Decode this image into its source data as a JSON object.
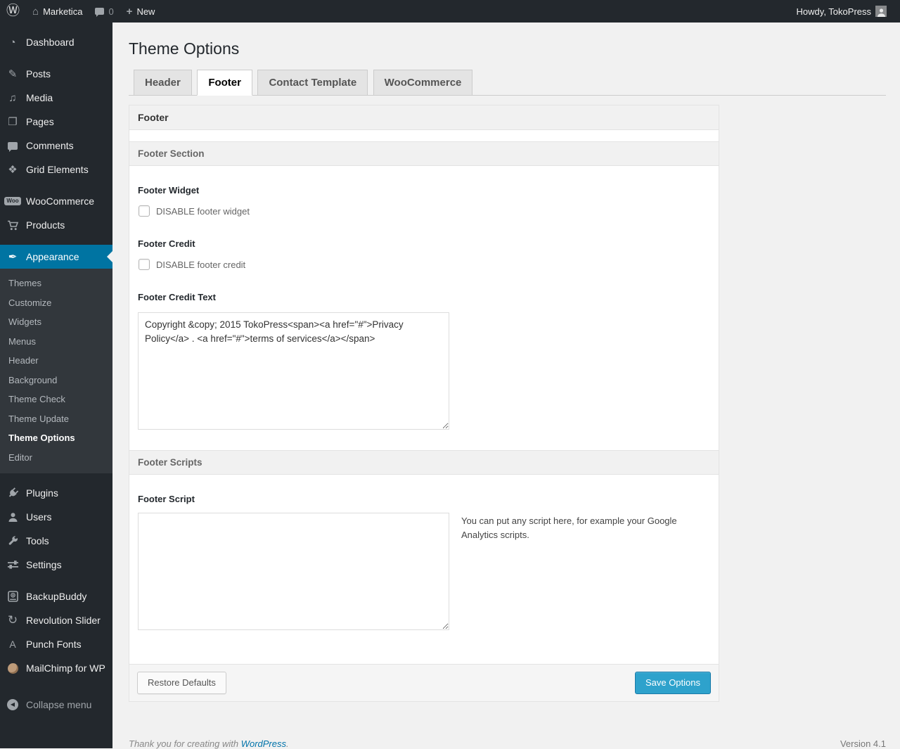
{
  "admin_bar": {
    "icons": {
      "wp": "Ⓦ",
      "home": "⌂",
      "plus": "+"
    },
    "site_name": "Marketica",
    "comments_count": "0",
    "new_label": "New",
    "howdy": "Howdy, TokoPress"
  },
  "sidebar": {
    "items": [
      {
        "label": "Dashboard",
        "glyph": "◔"
      },
      {
        "label": "Posts",
        "glyph": "✎"
      },
      {
        "label": "Media",
        "glyph": "♫"
      },
      {
        "label": "Pages",
        "glyph": "❐"
      },
      {
        "label": "Comments",
        "glyph": ""
      },
      {
        "label": "Grid Elements",
        "glyph": "❖"
      },
      {
        "label": "WooCommerce",
        "glyph": "Woo"
      },
      {
        "label": "Products",
        "glyph": ""
      },
      {
        "label": "Appearance",
        "glyph": "✒"
      },
      {
        "label": "Plugins",
        "glyph": ""
      },
      {
        "label": "Users",
        "glyph": ""
      },
      {
        "label": "Tools",
        "glyph": ""
      },
      {
        "label": "Settings",
        "glyph": ""
      },
      {
        "label": "BackupBuddy",
        "glyph": ""
      },
      {
        "label": "Revolution Slider",
        "glyph": "↻"
      },
      {
        "label": "Punch Fonts",
        "glyph": "A"
      },
      {
        "label": "MailChimp for WP",
        "glyph": ""
      },
      {
        "label": "Collapse menu",
        "glyph": "◀"
      }
    ],
    "submenu": [
      "Themes",
      "Customize",
      "Widgets",
      "Menus",
      "Header",
      "Background",
      "Theme Check",
      "Theme Update",
      "Theme Options",
      "Editor"
    ]
  },
  "main": {
    "title": "Theme Options",
    "tabs": [
      {
        "label": "Header"
      },
      {
        "label": "Footer"
      },
      {
        "label": "Contact Template"
      },
      {
        "label": "WooCommerce"
      }
    ],
    "panel": {
      "group_header": "Footer",
      "section_header": "Footer Section",
      "footer_widget_label": "Footer Widget",
      "footer_widget_checkbox": "DISABLE footer widget",
      "footer_credit_label": "Footer Credit",
      "footer_credit_checkbox": "DISABLE footer credit",
      "footer_credit_text_label": "Footer Credit Text",
      "footer_credit_text_value": "Copyright &copy; 2015 TokoPress<span><a href=\"#\">Privacy Policy</a> . <a href=\"#\">terms of services</a></span>",
      "scripts_header": "Footer Scripts",
      "footer_script_label": "Footer Script",
      "footer_script_value": "",
      "footer_script_hint": "You can put any script here, for example your Google Analytics scripts.",
      "restore_button": "Restore Defaults",
      "save_button": "Save Options"
    }
  },
  "footer": {
    "thanks_prefix": "Thank you for creating with ",
    "wordpress_link": "WordPress",
    "thanks_suffix": ".",
    "version": "Version 4.1"
  },
  "colors": {
    "menu_highlight": "#0074a2",
    "primary_button": "#2ea2cc",
    "admin_bar_bg": "#23282d",
    "page_bg": "#f1f1f1"
  }
}
